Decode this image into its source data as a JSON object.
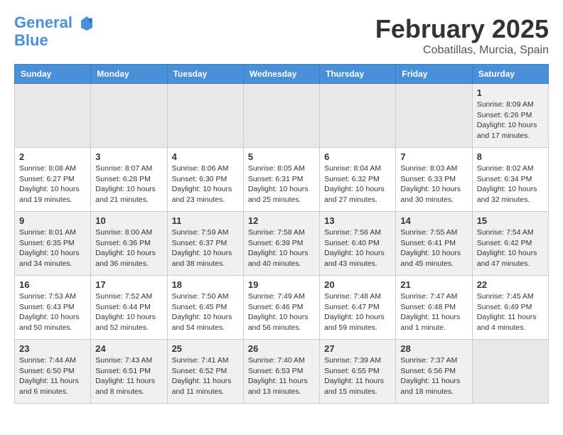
{
  "logo": {
    "line1": "General",
    "line2": "Blue"
  },
  "title": "February 2025",
  "location": "Cobatillas, Murcia, Spain",
  "weekdays": [
    "Sunday",
    "Monday",
    "Tuesday",
    "Wednesday",
    "Thursday",
    "Friday",
    "Saturday"
  ],
  "weeks": [
    [
      {
        "day": "",
        "info": ""
      },
      {
        "day": "",
        "info": ""
      },
      {
        "day": "",
        "info": ""
      },
      {
        "day": "",
        "info": ""
      },
      {
        "day": "",
        "info": ""
      },
      {
        "day": "",
        "info": ""
      },
      {
        "day": "1",
        "info": "Sunrise: 8:09 AM\nSunset: 6:26 PM\nDaylight: 10 hours\nand 17 minutes."
      }
    ],
    [
      {
        "day": "2",
        "info": "Sunrise: 8:08 AM\nSunset: 6:27 PM\nDaylight: 10 hours\nand 19 minutes."
      },
      {
        "day": "3",
        "info": "Sunrise: 8:07 AM\nSunset: 6:28 PM\nDaylight: 10 hours\nand 21 minutes."
      },
      {
        "day": "4",
        "info": "Sunrise: 8:06 AM\nSunset: 6:30 PM\nDaylight: 10 hours\nand 23 minutes."
      },
      {
        "day": "5",
        "info": "Sunrise: 8:05 AM\nSunset: 6:31 PM\nDaylight: 10 hours\nand 25 minutes."
      },
      {
        "day": "6",
        "info": "Sunrise: 8:04 AM\nSunset: 6:32 PM\nDaylight: 10 hours\nand 27 minutes."
      },
      {
        "day": "7",
        "info": "Sunrise: 8:03 AM\nSunset: 6:33 PM\nDaylight: 10 hours\nand 30 minutes."
      },
      {
        "day": "8",
        "info": "Sunrise: 8:02 AM\nSunset: 6:34 PM\nDaylight: 10 hours\nand 32 minutes."
      }
    ],
    [
      {
        "day": "9",
        "info": "Sunrise: 8:01 AM\nSunset: 6:35 PM\nDaylight: 10 hours\nand 34 minutes."
      },
      {
        "day": "10",
        "info": "Sunrise: 8:00 AM\nSunset: 6:36 PM\nDaylight: 10 hours\nand 36 minutes."
      },
      {
        "day": "11",
        "info": "Sunrise: 7:59 AM\nSunset: 6:37 PM\nDaylight: 10 hours\nand 38 minutes."
      },
      {
        "day": "12",
        "info": "Sunrise: 7:58 AM\nSunset: 6:39 PM\nDaylight: 10 hours\nand 40 minutes."
      },
      {
        "day": "13",
        "info": "Sunrise: 7:56 AM\nSunset: 6:40 PM\nDaylight: 10 hours\nand 43 minutes."
      },
      {
        "day": "14",
        "info": "Sunrise: 7:55 AM\nSunset: 6:41 PM\nDaylight: 10 hours\nand 45 minutes."
      },
      {
        "day": "15",
        "info": "Sunrise: 7:54 AM\nSunset: 6:42 PM\nDaylight: 10 hours\nand 47 minutes."
      }
    ],
    [
      {
        "day": "16",
        "info": "Sunrise: 7:53 AM\nSunset: 6:43 PM\nDaylight: 10 hours\nand 50 minutes."
      },
      {
        "day": "17",
        "info": "Sunrise: 7:52 AM\nSunset: 6:44 PM\nDaylight: 10 hours\nand 52 minutes."
      },
      {
        "day": "18",
        "info": "Sunrise: 7:50 AM\nSunset: 6:45 PM\nDaylight: 10 hours\nand 54 minutes."
      },
      {
        "day": "19",
        "info": "Sunrise: 7:49 AM\nSunset: 6:46 PM\nDaylight: 10 hours\nand 56 minutes."
      },
      {
        "day": "20",
        "info": "Sunrise: 7:48 AM\nSunset: 6:47 PM\nDaylight: 10 hours\nand 59 minutes."
      },
      {
        "day": "21",
        "info": "Sunrise: 7:47 AM\nSunset: 6:48 PM\nDaylight: 11 hours\nand 1 minute."
      },
      {
        "day": "22",
        "info": "Sunrise: 7:45 AM\nSunset: 6:49 PM\nDaylight: 11 hours\nand 4 minutes."
      }
    ],
    [
      {
        "day": "23",
        "info": "Sunrise: 7:44 AM\nSunset: 6:50 PM\nDaylight: 11 hours\nand 6 minutes."
      },
      {
        "day": "24",
        "info": "Sunrise: 7:43 AM\nSunset: 6:51 PM\nDaylight: 11 hours\nand 8 minutes."
      },
      {
        "day": "25",
        "info": "Sunrise: 7:41 AM\nSunset: 6:52 PM\nDaylight: 11 hours\nand 11 minutes."
      },
      {
        "day": "26",
        "info": "Sunrise: 7:40 AM\nSunset: 6:53 PM\nDaylight: 11 hours\nand 13 minutes."
      },
      {
        "day": "27",
        "info": "Sunrise: 7:39 AM\nSunset: 6:55 PM\nDaylight: 11 hours\nand 15 minutes."
      },
      {
        "day": "28",
        "info": "Sunrise: 7:37 AM\nSunset: 6:56 PM\nDaylight: 11 hours\nand 18 minutes."
      },
      {
        "day": "",
        "info": ""
      }
    ]
  ]
}
